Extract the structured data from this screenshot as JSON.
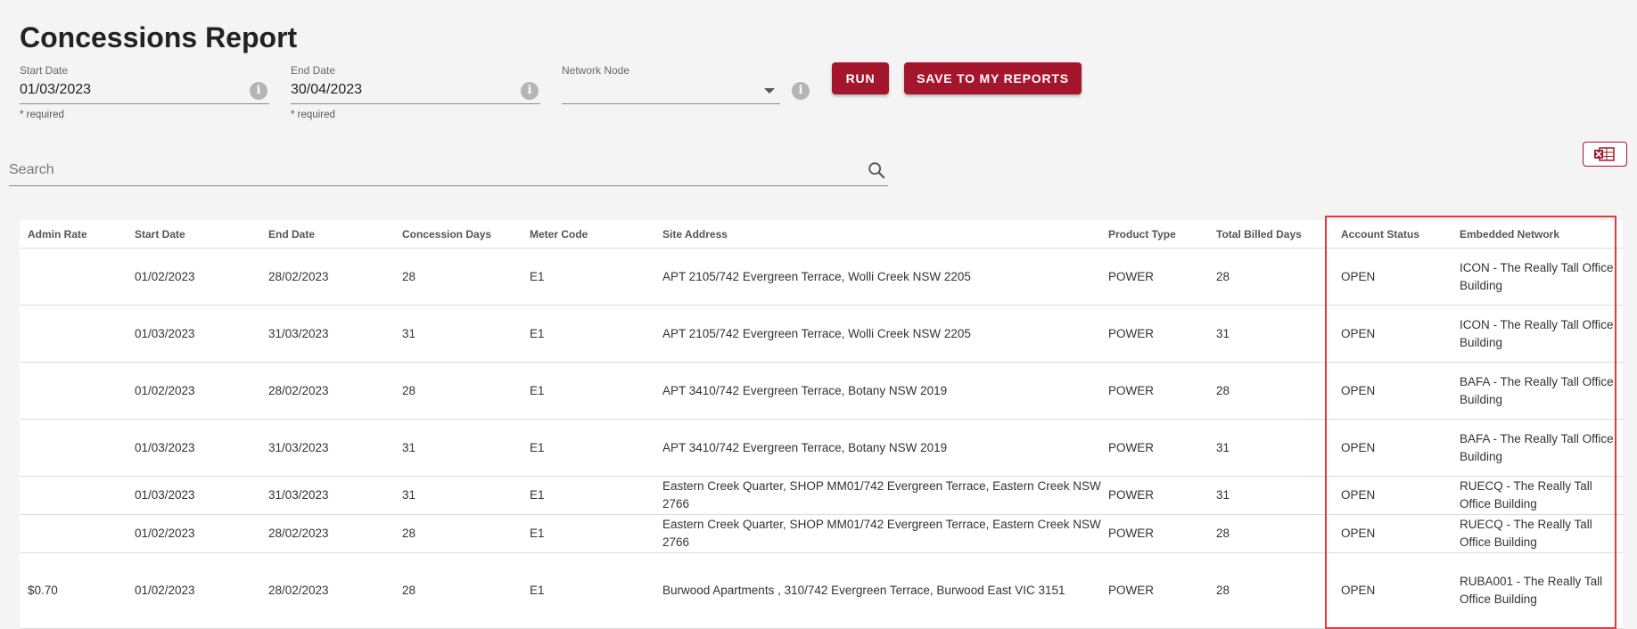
{
  "page": {
    "title": "Concessions Report"
  },
  "filters": {
    "start_date": {
      "label": "Start Date",
      "value": "01/03/2023",
      "hint": "* required"
    },
    "end_date": {
      "label": "End Date",
      "value": "30/04/2023",
      "hint": "* required"
    },
    "network_node": {
      "label": "Network Node",
      "value": ""
    }
  },
  "buttons": {
    "run": "RUN",
    "save": "SAVE TO MY REPORTS"
  },
  "search": {
    "placeholder": "Search"
  },
  "table": {
    "columns": [
      "Admin Rate",
      "Start Date",
      "End Date",
      "Concession Days",
      "Meter Code",
      "Site Address",
      "Product Type",
      "Total Billed Days",
      "Account Status",
      "Embedded Network"
    ],
    "rows": [
      [
        "",
        "01/02/2023",
        "28/02/2023",
        "28",
        "E1",
        "APT 2105/742 Evergreen Terrace, Wolli Creek NSW 2205",
        "POWER",
        "28",
        "OPEN",
        "ICON - The Really Tall Office Building"
      ],
      [
        "",
        "01/03/2023",
        "31/03/2023",
        "31",
        "E1",
        "APT 2105/742 Evergreen Terrace, Wolli Creek NSW 2205",
        "POWER",
        "31",
        "OPEN",
        "ICON - The Really Tall Office Building"
      ],
      [
        "",
        "01/02/2023",
        "28/02/2023",
        "28",
        "E1",
        "APT 3410/742 Evergreen Terrace, Botany NSW 2019",
        "POWER",
        "28",
        "OPEN",
        "BAFA - The Really Tall Office Building"
      ],
      [
        "",
        "01/03/2023",
        "31/03/2023",
        "31",
        "E1",
        "APT 3410/742 Evergreen Terrace, Botany NSW 2019",
        "POWER",
        "31",
        "OPEN",
        "BAFA - The Really Tall Office Building"
      ],
      [
        "",
        "01/03/2023",
        "31/03/2023",
        "31",
        "E1",
        "Eastern Creek Quarter, SHOP MM01/742 Evergreen Terrace, Eastern Creek NSW 2766",
        "POWER",
        "31",
        "OPEN",
        "RUECQ - The Really Tall Office Building"
      ],
      [
        "",
        "01/02/2023",
        "28/02/2023",
        "28",
        "E1",
        "Eastern Creek Quarter, SHOP MM01/742 Evergreen Terrace, Eastern Creek NSW 2766",
        "POWER",
        "28",
        "OPEN",
        "RUECQ - The Really Tall Office Building"
      ],
      [
        "$0.70",
        "01/02/2023",
        "28/02/2023",
        "28",
        "E1",
        "Burwood Apartments , 310/742 Evergreen Terrace, Burwood East VIC 3151",
        "POWER",
        "28",
        "OPEN",
        "RUBA001 - The Really Tall Office Building"
      ]
    ]
  },
  "colors": {
    "brand": "#a4162b",
    "highlight": "#e03a3a"
  },
  "icons": {
    "info": "info-icon",
    "search": "search-icon",
    "excel": "excel-export-icon"
  }
}
